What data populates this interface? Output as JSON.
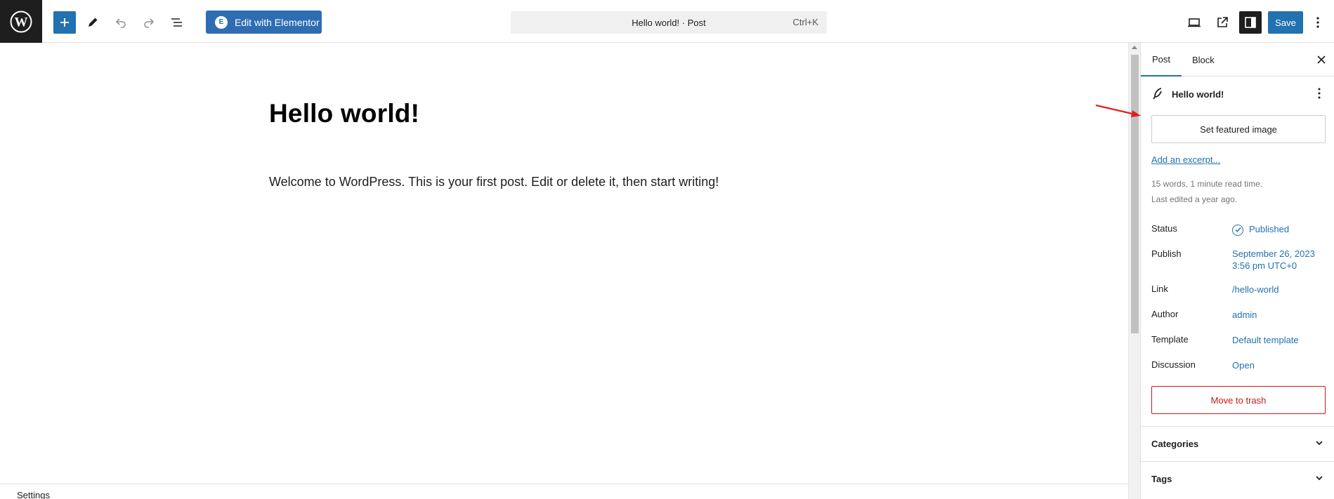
{
  "toolbar": {
    "elementor_label": "Edit with Elementor",
    "elementor_badge": "E",
    "command_text": "Hello world! · Post",
    "command_shortcut": "Ctrl+K",
    "save_label": "Save",
    "accent_color": "#2271b1"
  },
  "editor": {
    "title": "Hello world!",
    "paragraph": "Welcome to WordPress. This is your first post. Edit or delete it, then start writing!",
    "bottom_left": "Settings"
  },
  "sidebar": {
    "tabs": [
      {
        "label": "Post"
      },
      {
        "label": "Block"
      }
    ],
    "summary_title": "Hello world!",
    "featured_image_label": "Set featured image",
    "excerpt_label": "Add an excerpt...",
    "word_count": "15 words, 1 minute read time.",
    "last_edited": "Last edited a year ago.",
    "fields": [
      {
        "label": "Status",
        "value": "Published"
      },
      {
        "label": "Publish",
        "value": "September 26, 2023",
        "value2": "3:56 pm UTC+0"
      },
      {
        "label": "Link",
        "value": "/hello-world"
      },
      {
        "label": "Author",
        "value": "admin"
      },
      {
        "label": "Template",
        "value": "Default template"
      },
      {
        "label": "Discussion",
        "value": "Open"
      }
    ],
    "trash_label": "Move to trash",
    "panels": [
      {
        "title": "Categories"
      },
      {
        "title": "Tags"
      }
    ]
  },
  "icons": [
    "wordpress-logo-icon",
    "plus-icon",
    "pencil-icon",
    "undo-icon",
    "redo-icon",
    "list-view-icon",
    "desktop-preview-icon",
    "external-link-icon",
    "sidebar-toggle-icon",
    "more-vertical-icon",
    "close-icon",
    "feather-icon",
    "check-circle-icon",
    "chevron-down-icon"
  ]
}
